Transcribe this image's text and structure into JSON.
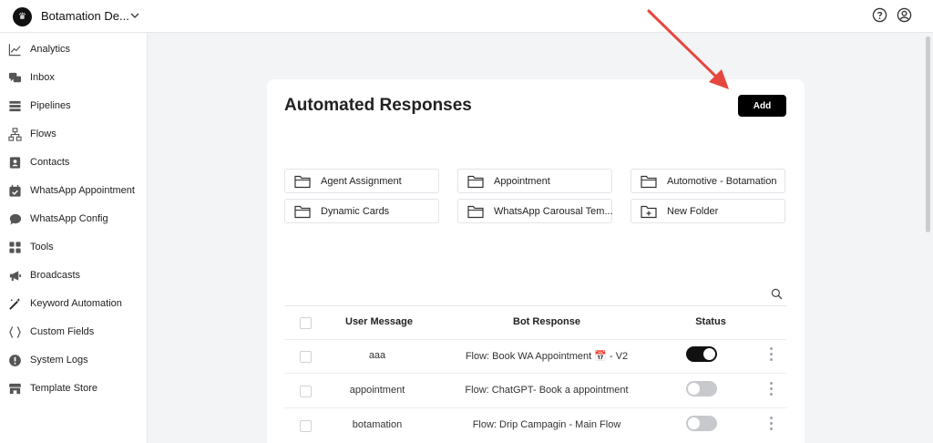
{
  "header": {
    "logo_glyph": "♛",
    "workspace_name": "Botamation De..."
  },
  "sidebar": {
    "items": [
      {
        "label": "Analytics",
        "icon": "chart-line-icon"
      },
      {
        "label": "Inbox",
        "icon": "chat-bubbles-icon"
      },
      {
        "label": "Pipelines",
        "icon": "pipelines-icon"
      },
      {
        "label": "Flows",
        "icon": "flow-tree-icon"
      },
      {
        "label": "Contacts",
        "icon": "contact-card-icon"
      },
      {
        "label": "WhatsApp Appointment",
        "icon": "calendar-check-icon"
      },
      {
        "label": "WhatsApp Config",
        "icon": "chat-icon"
      },
      {
        "label": "Tools",
        "icon": "grid-icon"
      },
      {
        "label": "Broadcasts",
        "icon": "megaphone-icon"
      },
      {
        "label": "Keyword Automation",
        "icon": "magic-wand-icon"
      },
      {
        "label": "Custom Fields",
        "icon": "braces-icon"
      },
      {
        "label": "System Logs",
        "icon": "alert-circle-icon"
      },
      {
        "label": "Template Store",
        "icon": "store-icon"
      }
    ]
  },
  "main": {
    "title": "Automated Responses",
    "add_label": "Add",
    "folders": [
      {
        "label": "Agent Assignment"
      },
      {
        "label": "Appointment"
      },
      {
        "label": "Automotive - Botamation"
      },
      {
        "label": "Dynamic Cards"
      },
      {
        "label": "WhatsApp Carousal Tem..."
      },
      {
        "label": "New Folder"
      }
    ],
    "table": {
      "headers": {
        "user_message": "User Message",
        "bot_response": "Bot Response",
        "status": "Status"
      },
      "rows": [
        {
          "user_message": "aaa",
          "bot_response": "Flow: Book WA Appointment 📅 - V2",
          "status_on": true
        },
        {
          "user_message": "appointment",
          "bot_response": "Flow: ChatGPT- Book a appointment",
          "status_on": false
        },
        {
          "user_message": "botamation",
          "bot_response": "Flow: Drip Campagin - Main Flow",
          "status_on": false
        }
      ]
    }
  },
  "colors": {
    "accent": "#000000",
    "toggle_off": "#c7c9cc",
    "annotation_arrow": "#e5473f",
    "background": "#f3f4f6"
  }
}
